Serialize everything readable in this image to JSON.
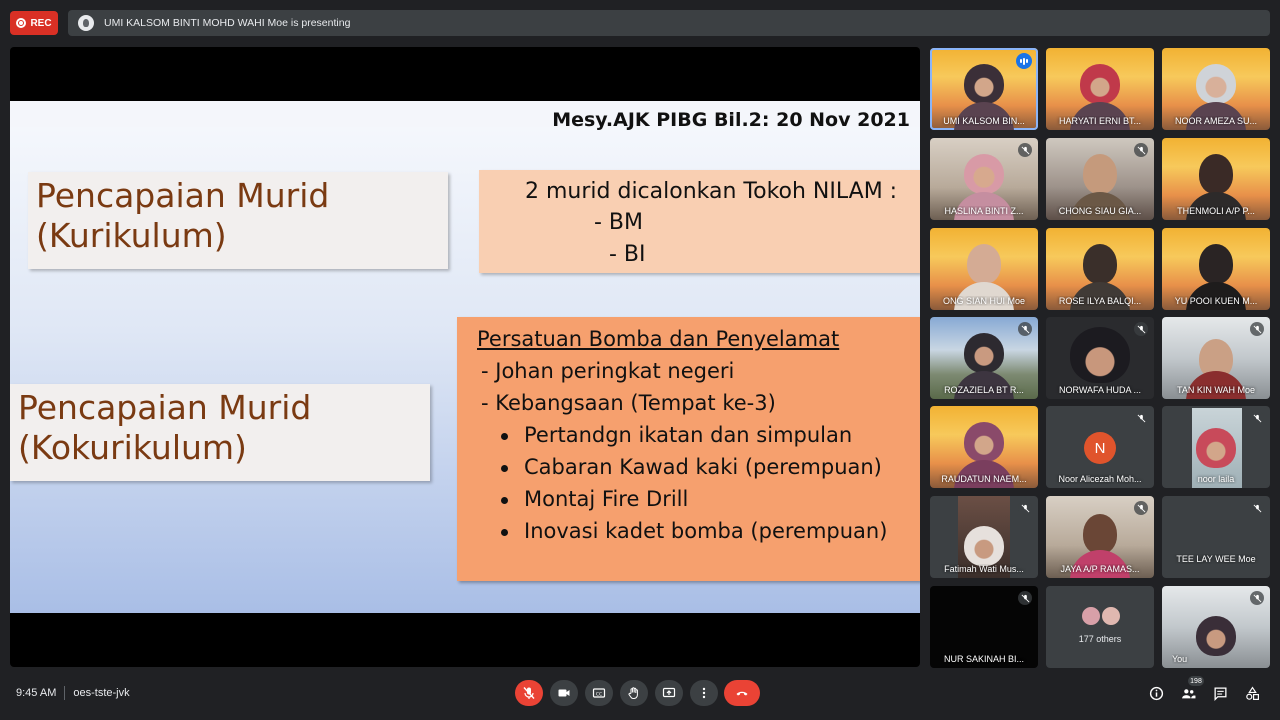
{
  "topbar": {
    "rec_label": "REC",
    "presenter_text": "UMI KALSOM BINTI MOHD WAHI Moe is presenting"
  },
  "slide": {
    "header": "Mesy.AJK PIBG Bil.2: 20 Nov 2021",
    "kurikulum_title_1": "Pencapaian Murid",
    "kurikulum_title_2": "(Kurikulum)",
    "kurikulum_line_1": "2 murid dicalonkan Tokoh NILAM :",
    "kurikulum_line_2": "-    BM",
    "kurikulum_line_3": "-    BI",
    "kokurikulum_title_1": "Pencapaian Murid",
    "kokurikulum_title_2": "(Kokurikulum)",
    "koko_heading": "Persatuan Bomba dan Penyelamat",
    "koko_sub_1": "- Johan peringkat negeri",
    "koko_sub_2": "- Kebangsaan (Tempat ke-3)",
    "koko_bullets": [
      "Pertandgn ikatan dan simpulan",
      "Cabaran Kawad kaki (perempuan)",
      "Montaj Fire Drill",
      "Inovasi kadet bomba (perempuan)"
    ]
  },
  "participants": [
    {
      "name": "UMI KALSOM BIN..."
    },
    {
      "name": "HARYATI ERNI BT..."
    },
    {
      "name": "NOOR AMEZA SU..."
    },
    {
      "name": "HASLINA BINTI Z..."
    },
    {
      "name": "CHONG SIAU GIA..."
    },
    {
      "name": "THENMOLI A/P P..."
    },
    {
      "name": "ONG SIAN HUI Moe"
    },
    {
      "name": "ROSE ILYA BALQI..."
    },
    {
      "name": "YU POOI KUEN M..."
    },
    {
      "name": "ROZAZIELA BT R..."
    },
    {
      "name": "NORWAFA HUDA ..."
    },
    {
      "name": "TAN KIN WAH Moe"
    },
    {
      "name": "RAUDATUN NAEM..."
    },
    {
      "name": "Noor Alicezah Moh...",
      "initial": "N"
    },
    {
      "name": "noor laila"
    },
    {
      "name": "Fatimah Wati Mus..."
    },
    {
      "name": "JAYA A/P RAMAS..."
    },
    {
      "name": "TEE LAY WEE Moe"
    },
    {
      "name": "NUR SAKINAH BI..."
    },
    {
      "name": "177 others"
    },
    {
      "name": "You"
    }
  ],
  "bottombar": {
    "time": "9:45 AM",
    "meeting_code": "oes-tste-jvk",
    "people_count": "198"
  }
}
